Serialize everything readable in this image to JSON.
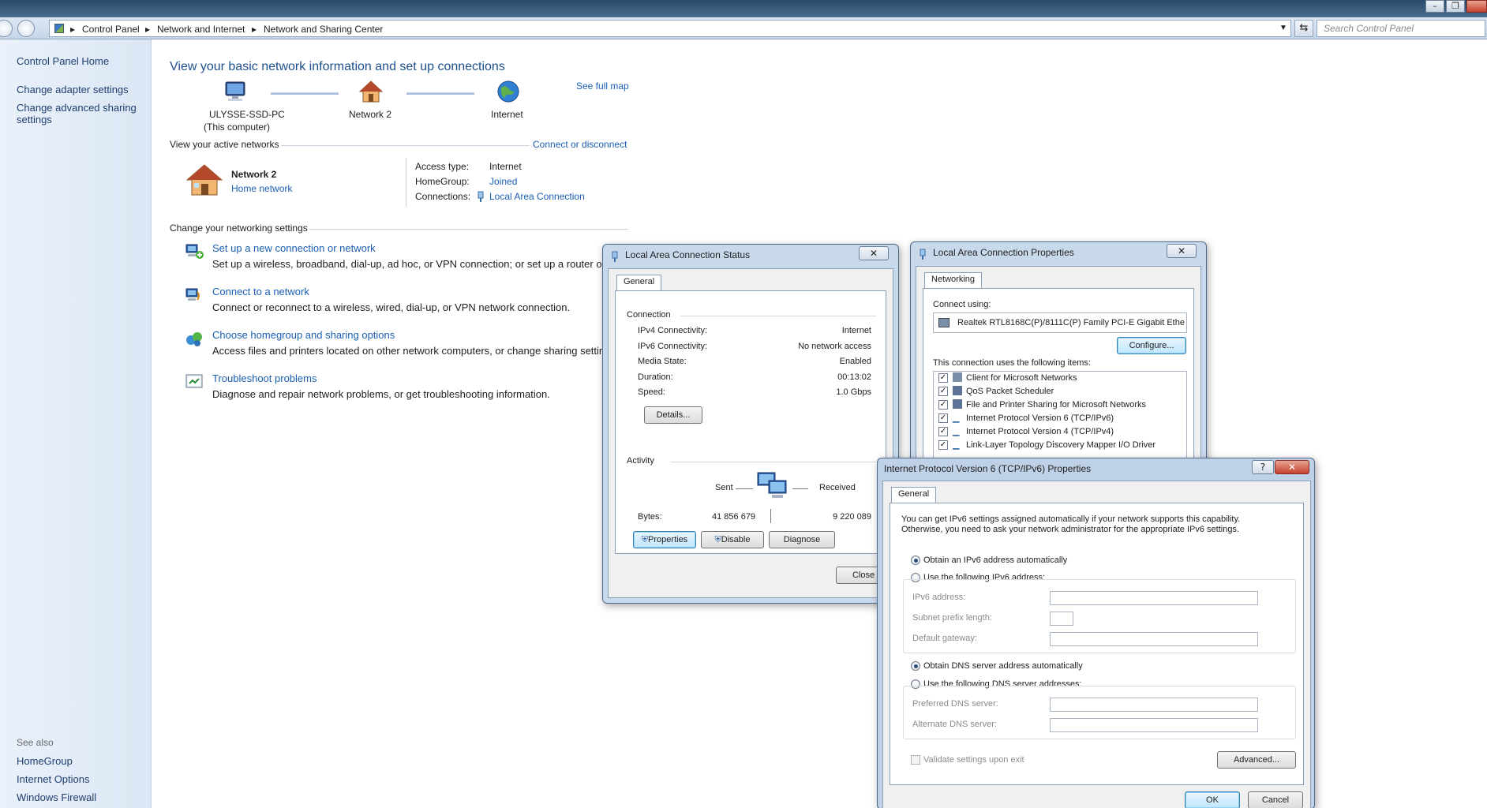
{
  "window": {
    "minimize": "–",
    "maximize": "❐"
  },
  "address": {
    "crumbs": [
      "Control Panel",
      "Network and Internet",
      "Network and Sharing Center"
    ],
    "search_placeholder": "Search Control Panel"
  },
  "leftnav": {
    "home": "Control Panel Home",
    "links": [
      "Change adapter settings",
      "Change advanced sharing",
      "settings"
    ],
    "see_also_title": "See also",
    "see_also": [
      "HomeGroup",
      "Internet Options",
      "Windows Firewall"
    ]
  },
  "main": {
    "title": "View your basic network information and set up connections",
    "see_full_map": "See full map",
    "map": {
      "computer_name": "ULYSSE-SSD-PC",
      "computer_sub": "(This computer)",
      "network": "Network  2",
      "internet": "Internet"
    },
    "active_networks_title": "View your active networks",
    "connect_or_disconnect": "Connect or disconnect",
    "network_name": "Network  2",
    "network_type": "Home network",
    "access_type_label": "Access type:",
    "access_type_value": "Internet",
    "homegroup_label": "HomeGroup:",
    "homegroup_value": "Joined",
    "connections_label": "Connections:",
    "connections_value": "Local Area Connection",
    "change_settings_title": "Change your networking settings",
    "tasks": [
      {
        "title": "Set up a new connection or network",
        "desc": "Set up a wireless, broadband, dial-up, ad hoc, or VPN connection; or set up a router or access p"
      },
      {
        "title": "Connect to a network",
        "desc": "Connect or reconnect to a wireless, wired, dial-up, or VPN network connection."
      },
      {
        "title": "Choose homegroup and sharing options",
        "desc": "Access files and printers located on other network computers, or change sharing settings."
      },
      {
        "title": "Troubleshoot problems",
        "desc": "Diagnose and repair network problems, or get troubleshooting information."
      }
    ]
  },
  "status_dialog": {
    "title": "Local Area Connection Status",
    "close_x": "✕",
    "tab": "General",
    "connection_title": "Connection",
    "rows": [
      {
        "label": "IPv4 Connectivity:",
        "value": "Internet"
      },
      {
        "label": "IPv6 Connectivity:",
        "value": "No network access"
      },
      {
        "label": "Media State:",
        "value": "Enabled"
      },
      {
        "label": "Duration:",
        "value": "00:13:02"
      },
      {
        "label": "Speed:",
        "value": "1.0 Gbps"
      }
    ],
    "details_button": "Details...",
    "activity_title": "Activity",
    "sent_label": "Sent",
    "received_label": "Received",
    "bytes_label": "Bytes:",
    "bytes_sent": "41 856 679",
    "bytes_received": "9 220 089",
    "properties_button": "Properties",
    "disable_button": "Disable",
    "diagnose_button": "Diagnose",
    "close_button": "Close"
  },
  "props_dialog": {
    "title": "Local Area Connection Properties",
    "close_x": "✕",
    "tab": "Networking",
    "connect_using_label": "Connect using:",
    "adapter": "Realtek RTL8168C(P)/8111C(P) Family PCI-E Gigabit Ethe",
    "configure_button": "Configure...",
    "items_label": "This connection uses the following items:",
    "items": [
      "Client for Microsoft Networks",
      "QoS Packet Scheduler",
      "File and Printer Sharing for Microsoft Networks",
      "Internet Protocol Version 6 (TCP/IPv6)",
      "Internet Protocol Version 4 (TCP/IPv4)",
      "Link-Layer Topology Discovery Mapper I/O Driver"
    ]
  },
  "ipv6_dialog": {
    "title": "Internet Protocol Version 6 (TCP/IPv6) Properties",
    "help": "?",
    "close_x": "✕",
    "tab": "General",
    "intro_line1": "You can get IPv6 settings assigned automatically if your network supports this capability.",
    "intro_line2": "Otherwise, you need to ask your network administrator for the appropriate IPv6 settings.",
    "obtain_ip_auto": "Obtain an IPv6 address automatically",
    "use_following_ip": "Use the following IPv6 address:",
    "ipv6_address_label": "IPv6 address:",
    "subnet_prefix_label": "Subnet prefix length:",
    "default_gateway_label": "Default gateway:",
    "obtain_dns_auto": "Obtain DNS server address automatically",
    "use_following_dns": "Use the following DNS server addresses:",
    "preferred_dns_label": "Preferred DNS server:",
    "alternate_dns_label": "Alternate DNS server:",
    "validate_label": "Validate settings upon exit",
    "advanced_button": "Advanced...",
    "ok_button": "OK",
    "cancel_button": "Cancel"
  }
}
